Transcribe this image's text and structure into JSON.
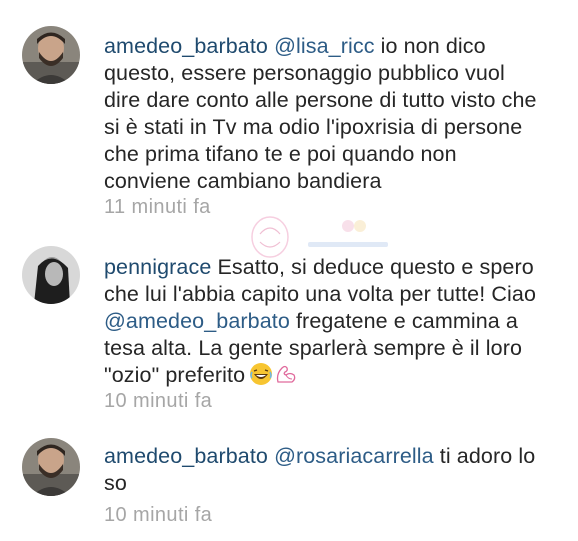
{
  "comments": [
    {
      "username": "amedeo_barbato",
      "mention": "@lisa_ricc",
      "text": " io non dico questo, essere personaggio pubblico vuol dire dare conto alle persone di tutto visto che si è stati in Tv ma odio l'ipoxrisia di persone che prima tifano te e poi quando non conviene cambiano bandiera",
      "time": "11 minuti fa"
    },
    {
      "username": "pennigrace",
      "text_before": " Esatto, si deduce questo e spero che lui l'abbia capito una volta per tutte! Ciao ",
      "mention": "@amedeo_barbato",
      "text_after": " fregatene e cammina a tesa alta. La gente sparlerà sempre è il loro \"ozio\" preferito",
      "emojis": [
        "laughing-emoji",
        "flexed-biceps-emoji"
      ],
      "time": "10 minuti fa"
    },
    {
      "username": "amedeo_barbato",
      "mention": "@rosariacarrella",
      "text": " ti adoro lo so",
      "time": "10 minuti fa"
    }
  ],
  "colors": {
    "username": "#1f4a6e",
    "mention": "#2d5c86",
    "body_text": "#262626",
    "time": "#a6a6a6"
  }
}
